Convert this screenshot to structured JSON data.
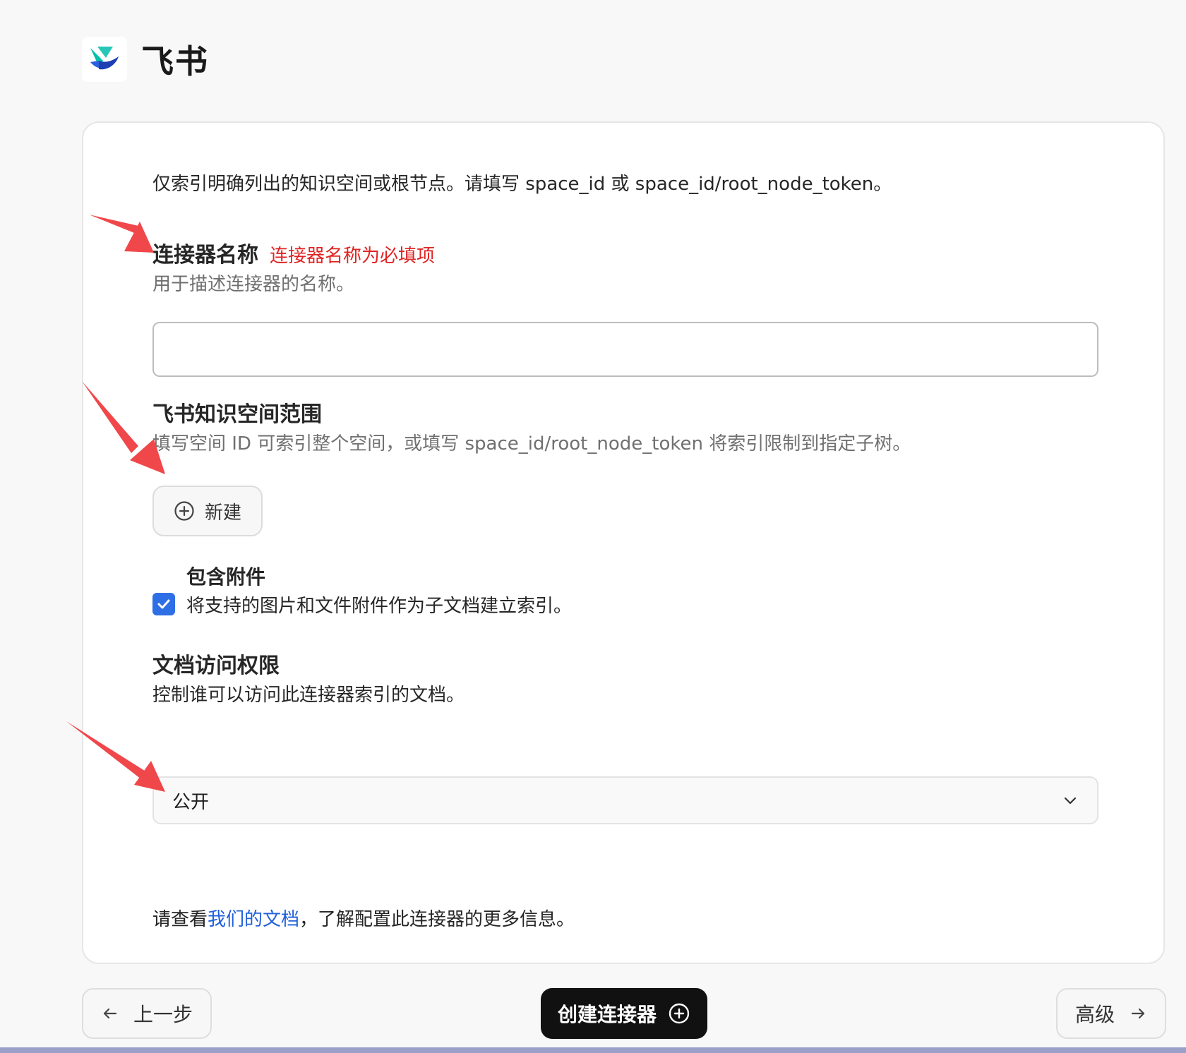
{
  "header": {
    "app_title": "飞书",
    "logo_icon": "feishu-logo-icon"
  },
  "intro_text": "仅索引明确列出的知识空间或根节点。请填写 space_id 或 space_id/root_node_token。",
  "connector_name": {
    "label": "连接器名称",
    "error": "连接器名称为必填项",
    "description": "用于描述连接器的名称。",
    "value": ""
  },
  "scope": {
    "label": "飞书知识空间范围",
    "description": "填写空间 ID 可索引整个空间，或填写 space_id/root_node_token 将索引限制到指定子树。",
    "new_button_label": "新建"
  },
  "attachments": {
    "label": "包含附件",
    "description": "将支持的图片和文件附件作为子文档建立索引。",
    "checked": true
  },
  "access": {
    "label": "文档访问权限",
    "description": "控制谁可以访问此连接器索引的文档。",
    "selected": "公开"
  },
  "footer_note": {
    "prefix": "请查看",
    "link": "我们的文档",
    "suffix": "，了解配置此连接器的更多信息。"
  },
  "nav": {
    "back_label": "上一步",
    "create_label": "创建连接器",
    "advanced_label": "高级"
  },
  "colors": {
    "accent": "#2f6fe6",
    "error": "#e02424",
    "link": "#1f5fdc",
    "primary_button": "#111111",
    "annotation_arrow": "#f0474a"
  }
}
